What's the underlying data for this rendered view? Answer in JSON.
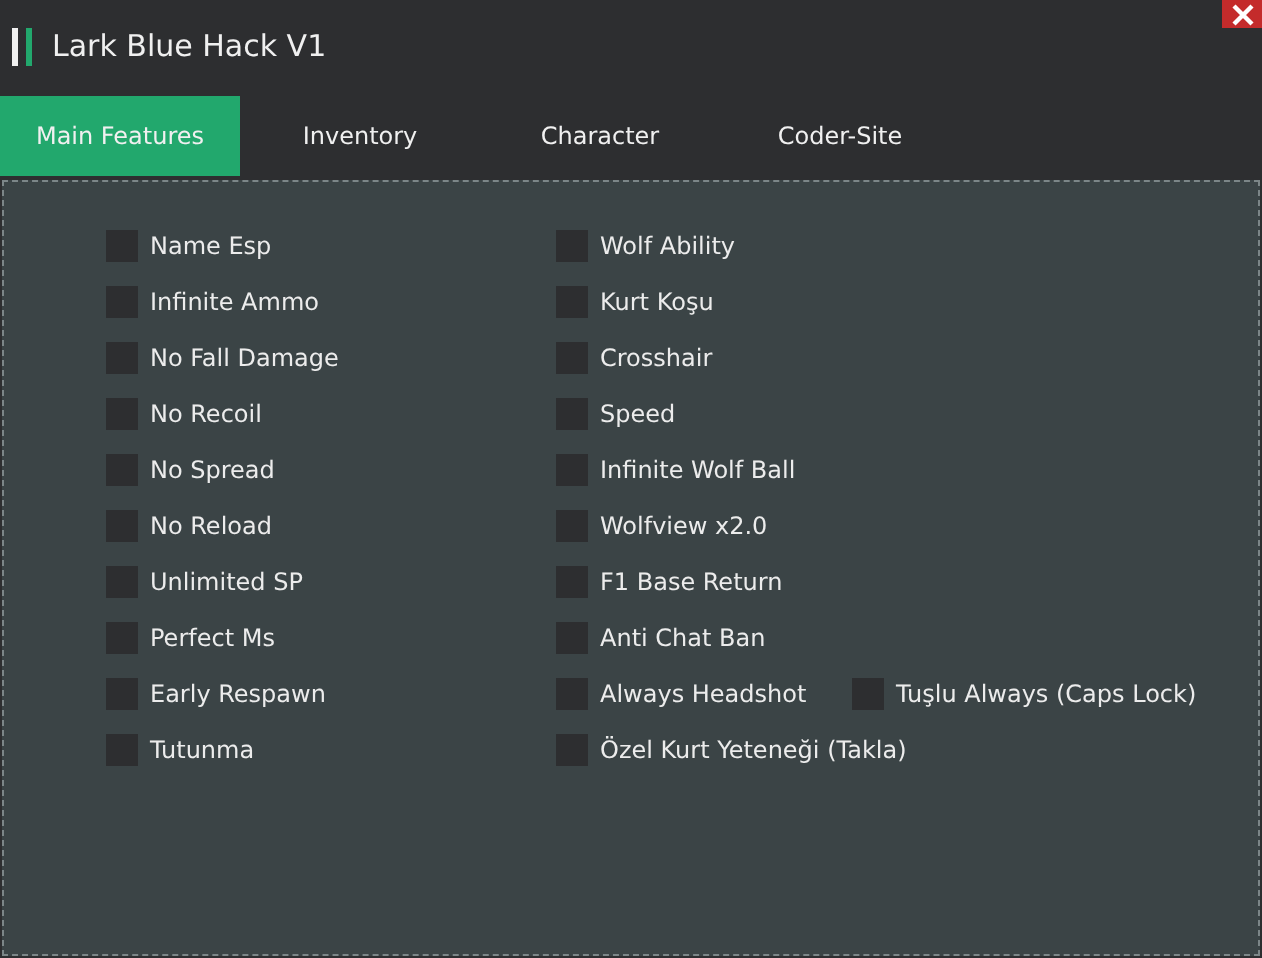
{
  "window": {
    "title": "Lark Blue Hack V1"
  },
  "tabs": [
    {
      "label": "Main Features",
      "selected": true
    },
    {
      "label": "Inventory",
      "selected": false
    },
    {
      "label": "Character",
      "selected": false
    },
    {
      "label": "Coder-Site",
      "selected": false
    }
  ],
  "rows": [
    [
      {
        "label": "Name Esp",
        "checked": false
      },
      {
        "label": "Wolf Ability",
        "checked": false
      }
    ],
    [
      {
        "label": "Infinite Ammo",
        "checked": false
      },
      {
        "label": "Kurt Koşu",
        "checked": false
      }
    ],
    [
      {
        "label": "No Fall Damage",
        "checked": false
      },
      {
        "label": "Crosshair",
        "checked": false
      }
    ],
    [
      {
        "label": "No Recoil",
        "checked": false
      },
      {
        "label": "Speed",
        "checked": false
      }
    ],
    [
      {
        "label": "No Spread",
        "checked": false
      },
      {
        "label": "Infinite Wolf Ball",
        "checked": false
      }
    ],
    [
      {
        "label": "No Reload",
        "checked": false
      },
      {
        "label": "Wolfview x2.0",
        "checked": false
      }
    ],
    [
      {
        "label": "Unlimited SP",
        "checked": false
      },
      {
        "label": "F1 Base Return",
        "checked": false
      }
    ],
    [
      {
        "label": "Perfect Ms",
        "checked": false
      },
      {
        "label": "Anti Chat Ban",
        "checked": false
      }
    ],
    [
      {
        "label": "Early Respawn",
        "checked": false
      },
      {
        "label": "Always Headshot",
        "checked": false
      },
      {
        "label": "Tuşlu Always (Caps Lock)",
        "checked": false
      }
    ],
    [
      {
        "label": "Tutunma",
        "checked": false
      },
      {
        "label": "Özel Kurt Yeteneği (Takla)",
        "checked": false
      }
    ]
  ]
}
